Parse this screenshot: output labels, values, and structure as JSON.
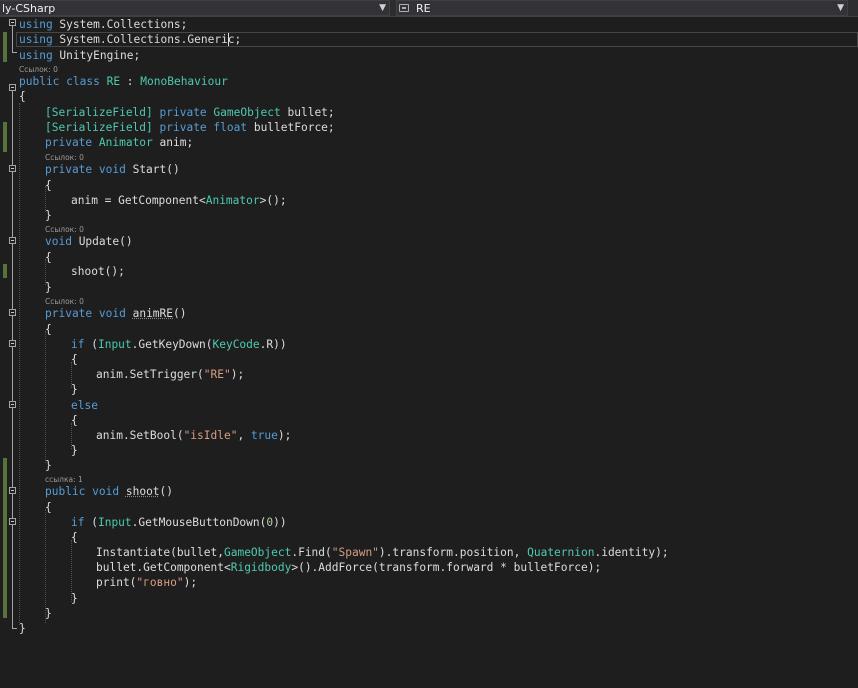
{
  "navbar": {
    "project": "ly-CSharp",
    "member": "RE"
  },
  "code_lens": {
    "refs_0": "Ссылок: 0",
    "refs_1": "ссылка: 1"
  },
  "code": {
    "using1_kw": "using",
    "using1_ns": " System.Collections;",
    "using2_kw": "using",
    "using2_ns": " System.Collections.Generic;",
    "using3_kw": "using",
    "using3_ns": " UnityEngine;",
    "cls_kw1": "public",
    "cls_kw2": " class",
    "cls_name": " RE",
    "cls_colon": " : ",
    "cls_base": "MonoBehaviour",
    "brace_open": "{",
    "brace_close": "}",
    "f1_attr": "[SerializeField]",
    "f1_mod": " private",
    "f1_type": " GameObject",
    "f1_name": " bullet;",
    "f2_attr": "[SerializeField]",
    "f2_mod": " private",
    "f2_type": " float",
    "f2_name": " bulletForce;",
    "f3_mod": "private",
    "f3_type": " Animator",
    "f3_name": " anim;",
    "start_mod": "private",
    "start_void": " void",
    "start_name": " Start()",
    "start_body_a": "anim = GetComponent<",
    "start_body_type": "Animator",
    "start_body_b": ">();",
    "update_void": "void",
    "update_name": " Update()",
    "update_body": "shoot();",
    "animre_mod": "private",
    "animre_void": " void",
    "animre_name_pre": " ",
    "animre_name": "animRE",
    "animre_paren": "()",
    "if1_kw": "if",
    "if1_a": " (",
    "if1_type": "Input",
    "if1_b": ".GetKeyDown(",
    "if1_type2": "KeyCode",
    "if1_c": ".R))",
    "trig_a": "anim.SetTrigger(",
    "trig_str": "\"RE\"",
    "trig_b": ");",
    "else_kw": "else",
    "bool_a": "anim.SetBool(",
    "bool_str": "\"isIdle\"",
    "bool_b": ", ",
    "bool_kw": "true",
    "bool_c": ");",
    "shoot_mod": "public",
    "shoot_void": " void",
    "shoot_pre": " ",
    "shoot_name": "shoot",
    "shoot_paren": "()",
    "if2_kw": "if",
    "if2_a": " (",
    "if2_type": "Input",
    "if2_b": ".GetMouseButtonDown(",
    "if2_num": "0",
    "if2_c": "))",
    "inst_a": "Instantiate(bullet,",
    "inst_type1": "GameObject",
    "inst_b": ".Find(",
    "inst_str": "\"Spawn\"",
    "inst_c": ").transform.position, ",
    "inst_type2": "Quaternion",
    "inst_d": ".identity);",
    "force_a": "bullet.GetComponent<",
    "force_type": "Rigidbody",
    "force_b": ">().AddForce(transform.forward * bulletForce);",
    "print_a": "print(",
    "print_str": "\"говно\"",
    "print_b": ");"
  }
}
